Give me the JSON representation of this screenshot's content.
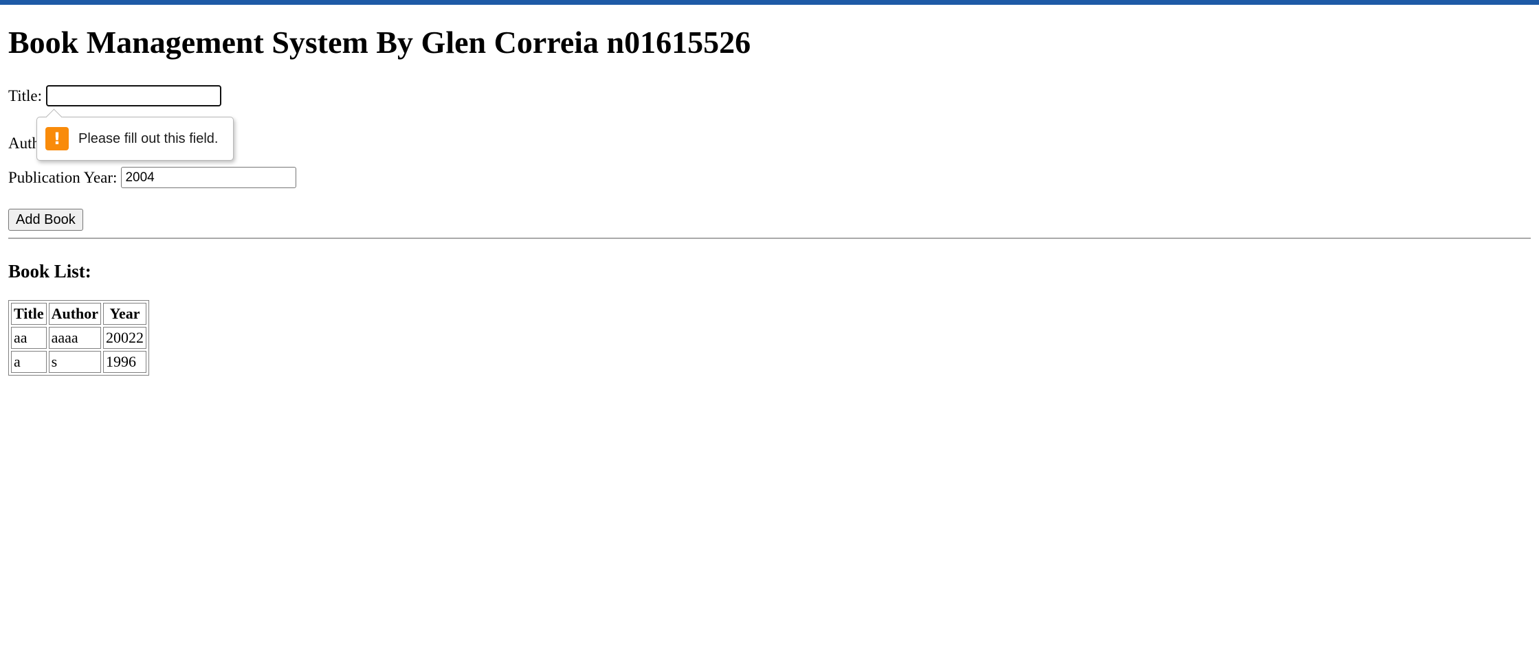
{
  "header": {
    "title": "Book Management System By Glen Correia n01615526"
  },
  "form": {
    "title_label": "Title:",
    "title_value": "",
    "author_label": "Auth",
    "author_value": "",
    "year_label": "Publication Year:",
    "year_value": "2004",
    "add_button_label": "Add Book"
  },
  "validation": {
    "message": "Please fill out this field.",
    "icon": "warning-icon",
    "icon_glyph": "!",
    "icon_color": "#f98b0a"
  },
  "book_list": {
    "heading": "Book List:",
    "columns": [
      "Title",
      "Author",
      "Year"
    ],
    "rows": [
      [
        "aa",
        "aaaa",
        "20022"
      ],
      [
        "a",
        "s",
        "1996"
      ]
    ]
  },
  "colors": {
    "top_bar": "#1e5aa6"
  }
}
